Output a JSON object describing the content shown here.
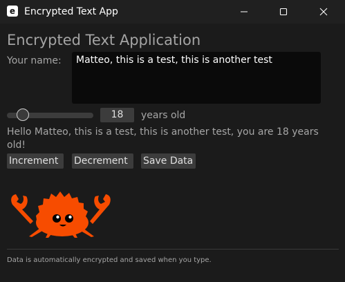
{
  "window": {
    "app_icon_letter": "e",
    "title": "Encrypted Text App",
    "controls": [
      "minimize-icon",
      "maximize-icon",
      "close-icon"
    ]
  },
  "main": {
    "heading": "Encrypted Text Application",
    "name_label": "Your name:",
    "name_value": "Matteo, this is a test, this is another test",
    "age": {
      "value": "18",
      "suffix": "years old",
      "slider_fraction": 0.18
    },
    "greeting": "Hello Matteo, this is a test, this is another test, you are 18 years old!",
    "buttons": {
      "increment": "Increment",
      "decrement": "Decrement",
      "save": "Save Data"
    },
    "mascot_icon": "ferris-crab-icon",
    "footer_note": "Data is automatically encrypted and saved when you type."
  },
  "colors": {
    "background": "#1b1b1b",
    "titlebar": "#202020",
    "text": "#a6a6a6",
    "input_bg": "#0a0a0a",
    "button_bg": "#3c3c3c",
    "mascot": "#f74c00"
  }
}
